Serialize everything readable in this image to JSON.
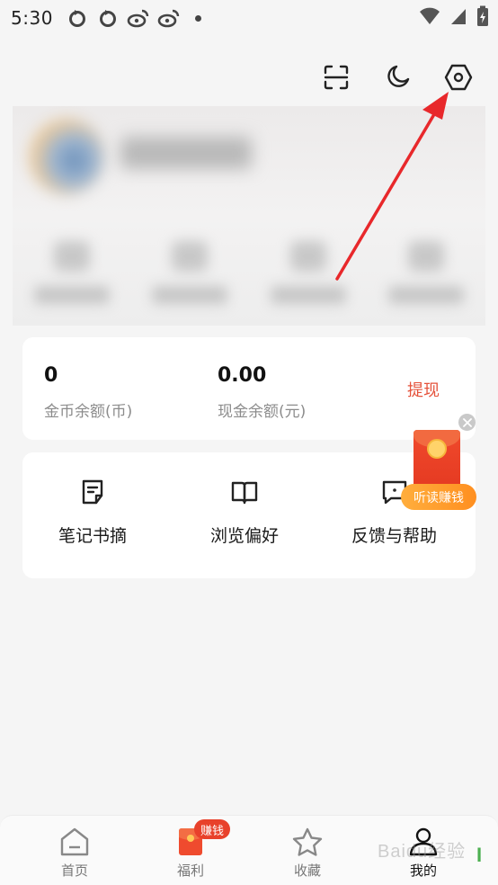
{
  "status_bar": {
    "time": "5:30",
    "left_icons": [
      "refresh-app-icon",
      "refresh-app-icon",
      "weibo-icon",
      "weibo-icon",
      "dot-icon"
    ],
    "right_icons": [
      "wifi-icon",
      "signal-icon",
      "battery-charging-icon"
    ]
  },
  "top_actions": [
    "scan-icon",
    "night-mode-icon",
    "settings-icon"
  ],
  "wallet": {
    "coins_value": "0",
    "coins_label": "金币余额(币)",
    "cash_value": "0.00",
    "cash_label": "现金余额(元)",
    "withdraw_label": "提现"
  },
  "tools": [
    {
      "label": "笔记书摘",
      "icon": "note-icon"
    },
    {
      "label": "浏览偏好",
      "icon": "book-icon"
    },
    {
      "label": "反馈与帮助",
      "icon": "feedback-icon"
    }
  ],
  "float_reward": {
    "label": "听读赚钱"
  },
  "bottom_nav": [
    {
      "label": "首页",
      "icon": "home-icon",
      "active": false
    },
    {
      "label": "福利",
      "icon": "red-packet-icon",
      "active": false,
      "badge": "赚钱"
    },
    {
      "label": "收藏",
      "icon": "star-icon",
      "active": false
    },
    {
      "label": "我的",
      "icon": "profile-icon",
      "active": true
    }
  ],
  "watermark": "Baidu经验",
  "colors": {
    "accent": "#e5533c",
    "annotation_arrow": "#e8282b",
    "badge": "#e8412b",
    "float_pill": "#ff9a2a"
  }
}
